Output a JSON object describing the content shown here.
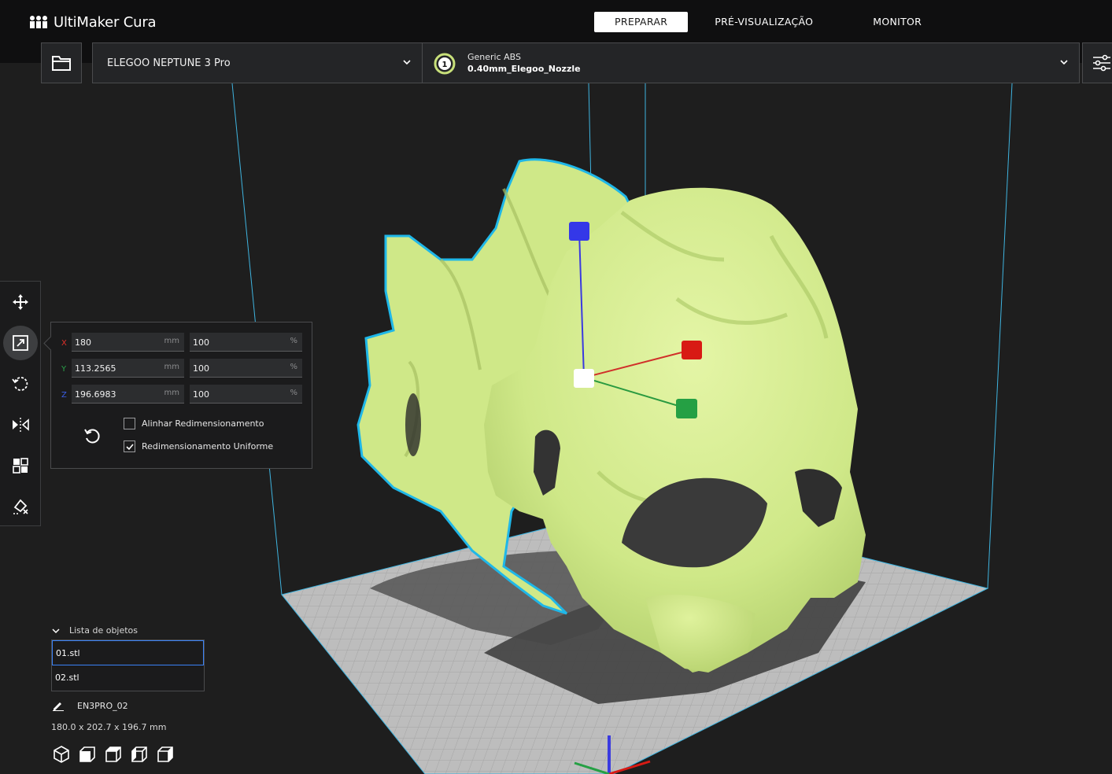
{
  "app": {
    "name": "UltiMaker Cura"
  },
  "stages": [
    {
      "label": "PREPARAR",
      "active": true
    },
    {
      "label": "PRÉ-VISUALIZAÇÃO",
      "active": false
    },
    {
      "label": "MONITOR",
      "active": false
    }
  ],
  "printer": {
    "name": "ELEGOO NEPTUNE 3 Pro"
  },
  "extruder": {
    "number": "1",
    "material": "Generic ABS",
    "nozzle": "0.40mm_Elegoo_Nozzle"
  },
  "scale_panel": {
    "rows": [
      {
        "axis": "X",
        "axis_color": "#e0302a",
        "mm": "180",
        "mm_unit": "mm",
        "percent": "100",
        "percent_unit": "%"
      },
      {
        "axis": "Y",
        "axis_color": "#2aa34a",
        "mm": "113.2565",
        "mm_unit": "mm",
        "percent": "100",
        "percent_unit": "%"
      },
      {
        "axis": "Z",
        "axis_color": "#3a5ee8",
        "mm": "196.6983",
        "mm_unit": "mm",
        "percent": "100",
        "percent_unit": "%"
      }
    ],
    "snap_scaling": {
      "label": "Alinhar Redimensionamento",
      "checked": false
    },
    "uniform_scaling": {
      "label": "Redimensionamento Uniforme",
      "checked": true
    }
  },
  "object_list": {
    "title": "Lista de objetos",
    "items": [
      {
        "name": "01.stl",
        "selected": true
      },
      {
        "name": "02.stl",
        "selected": false
      }
    ]
  },
  "job": {
    "name": "EN3PRO_02",
    "dimensions": "180.0 x 202.7 x 196.7 mm"
  },
  "colors": {
    "model": "#cfe888",
    "selection_outline": "#1fb7e8",
    "accent_blue": "#3a82f7",
    "build_plate": "#b9b9b9"
  }
}
